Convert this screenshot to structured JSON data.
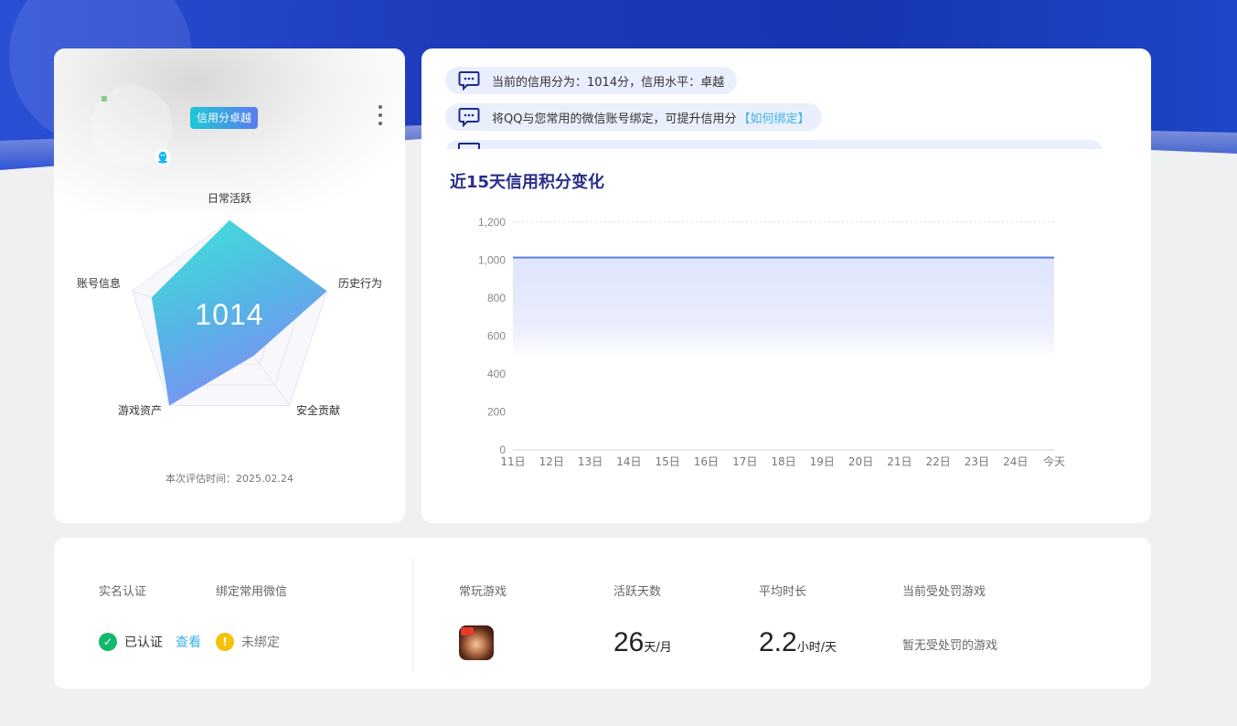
{
  "left": {
    "badge": "信用分卓越",
    "score": "1014",
    "eval_time": "本次评估时间：2025.02.24",
    "radar_axes": [
      {
        "label": "日常活跃",
        "value": 1.0
      },
      {
        "label": "历史行为",
        "value": 1.0
      },
      {
        "label": "安全贡献",
        "value": 0.4
      },
      {
        "label": "游戏资产",
        "value": 1.0
      },
      {
        "label": "账号信息",
        "value": 0.8
      }
    ]
  },
  "notices": [
    {
      "text": "当前的信用分为：1014分，信用水平：卓越",
      "link": ""
    },
    {
      "text": "将QQ与您常用的微信账号绑定，可提升信用分",
      "link": "【如何绑定】"
    }
  ],
  "trend": {
    "title": "近15天信用积分变化"
  },
  "chart_data": {
    "type": "area",
    "categories": [
      "11日",
      "12日",
      "13日",
      "14日",
      "15日",
      "16日",
      "17日",
      "18日",
      "19日",
      "20日",
      "21日",
      "22日",
      "23日",
      "24日",
      "今天"
    ],
    "series": [
      {
        "values": [
          1014,
          1014,
          1014,
          1014,
          1014,
          1014,
          1014,
          1014,
          1014,
          1014,
          1014,
          1014,
          1014,
          1014,
          1014
        ]
      }
    ],
    "yticks": [
      "0",
      "200",
      "400",
      "600",
      "800",
      "1,000",
      "1,200"
    ],
    "ylim": [
      0,
      1200
    ],
    "grid": "top-only dotted",
    "colors": {
      "line": "#5b7ce6",
      "fill": "#e4e9fb"
    }
  },
  "bottom": {
    "real_name_label": "实名认证",
    "wechat_label": "绑定常用微信",
    "verified": "已认证",
    "view": "查看",
    "unbound": "未绑定",
    "games_label": "常玩游戏",
    "active_days_label": "活跃天数",
    "avg_time_label": "平均时长",
    "punish_label": "当前受处罚游戏",
    "active_days": "26",
    "active_days_unit": "天/月",
    "avg_time": "2.2",
    "avg_time_unit": "小时/天",
    "punish_value": "暂无受处罚的游戏"
  }
}
